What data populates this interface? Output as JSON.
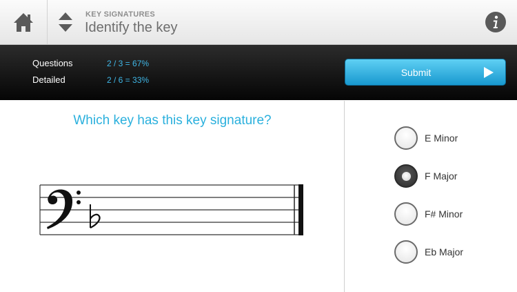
{
  "header": {
    "subtitle": "KEY SIGNATURES",
    "title": "Identify the key"
  },
  "stats": {
    "questions_label": "Questions",
    "questions_value": "2 / 3 = 67%",
    "detailed_label": "Detailed",
    "detailed_value": "2 / 6 = 33%"
  },
  "submit": {
    "label": "Submit"
  },
  "question": {
    "text": "Which key has this key signature?"
  },
  "staff": {
    "clef": "bass",
    "key_signature": "1 flat"
  },
  "options": [
    {
      "label": "E Minor",
      "selected": false
    },
    {
      "label": "F Major",
      "selected": true
    },
    {
      "label": "F# Minor",
      "selected": false
    },
    {
      "label": "Eb Major",
      "selected": false
    }
  ],
  "colors": {
    "accent": "#2ab0dd",
    "stat_value": "#3fb6e6",
    "submit_top": "#5fd0f4",
    "submit_bottom": "#1898cf"
  }
}
